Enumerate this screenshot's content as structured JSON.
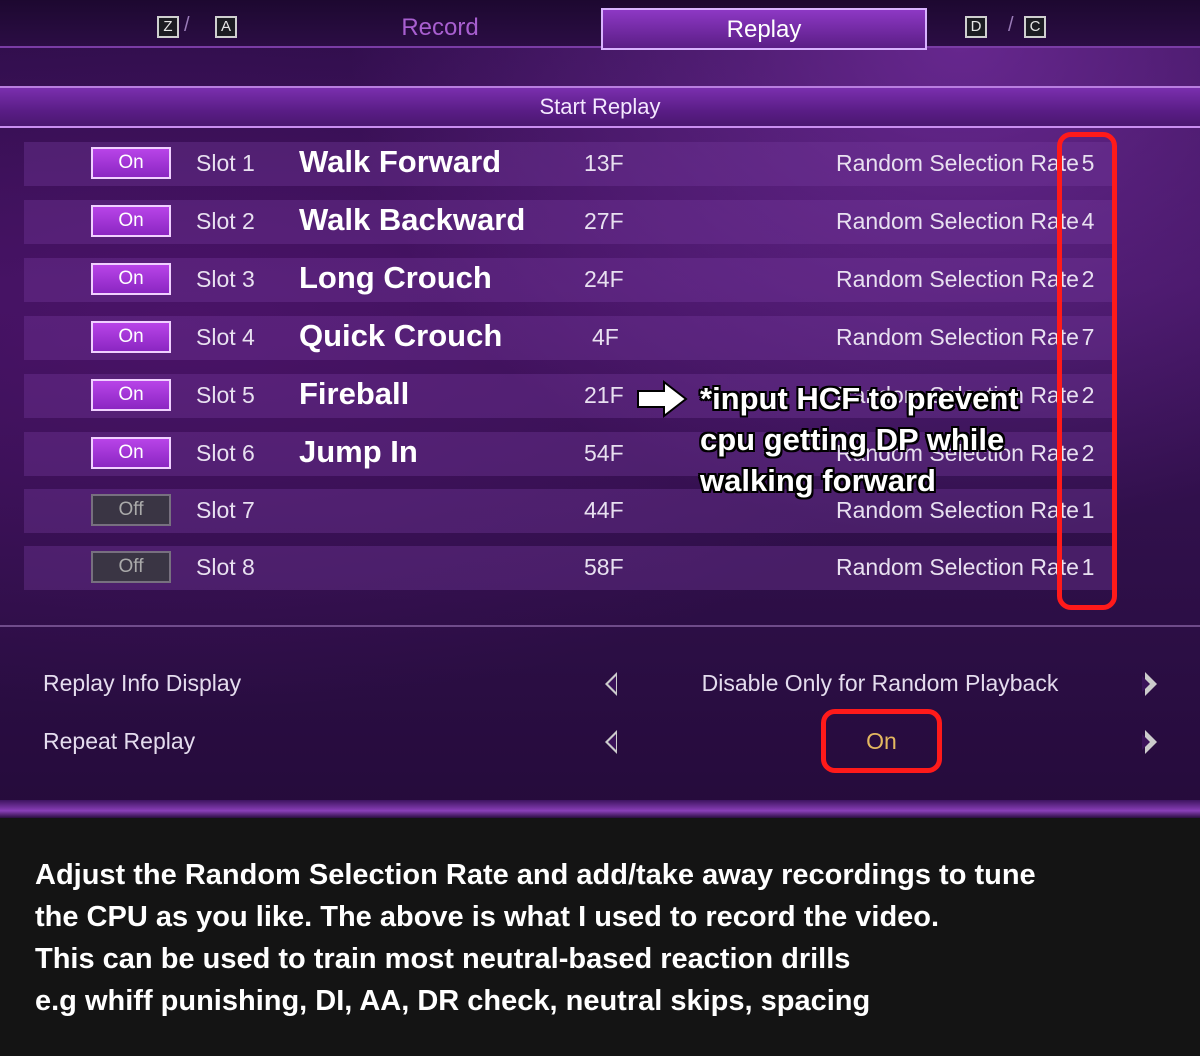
{
  "tabbar": {
    "left_keys": [
      "Z",
      "A"
    ],
    "right_keys": [
      "D",
      "C"
    ],
    "tabs": [
      {
        "label": "Record",
        "active": false
      },
      {
        "label": "Replay",
        "active": true
      }
    ]
  },
  "start_replay": {
    "label": "Start Replay"
  },
  "slots": [
    {
      "toggle": "On",
      "slot": "Slot 1",
      "move": "Walk Forward",
      "frames": "13F",
      "rate_label": "Random Selection Rate",
      "rate": "5"
    },
    {
      "toggle": "On",
      "slot": "Slot 2",
      "move": "Walk Backward",
      "frames": "27F",
      "rate_label": "Random Selection Rate",
      "rate": "4"
    },
    {
      "toggle": "On",
      "slot": "Slot 3",
      "move": "Long Crouch",
      "frames": "24F",
      "rate_label": "Random Selection Rate",
      "rate": "2"
    },
    {
      "toggle": "On",
      "slot": "Slot 4",
      "move": "Quick Crouch",
      "frames": "4F",
      "rate_label": "Random Selection Rate",
      "rate": "7"
    },
    {
      "toggle": "On",
      "slot": "Slot 5",
      "move": "Fireball",
      "frames": "21F",
      "rate_label": "Random Selection Rate",
      "rate": "2"
    },
    {
      "toggle": "On",
      "slot": "Slot 6",
      "move": "Jump In",
      "frames": "54F",
      "rate_label": "Random Selection Rate",
      "rate": "2"
    },
    {
      "toggle": "Off",
      "slot": "Slot 7",
      "move": "",
      "frames": "44F",
      "rate_label": "Random Selection Rate",
      "rate": "1"
    },
    {
      "toggle": "Off",
      "slot": "Slot 8",
      "move": "",
      "frames": "58F",
      "rate_label": "Random Selection Rate",
      "rate": "1"
    }
  ],
  "options": {
    "replay_info": {
      "label": "Replay Info Display",
      "value": "Disable Only for Random Playback"
    },
    "repeat_replay": {
      "label": "Repeat Replay",
      "value": "On"
    }
  },
  "annotation": {
    "lines": [
      "*input HCF to prevent",
      "cpu getting DP while",
      "walking forward"
    ]
  },
  "caption": {
    "lines": [
      "Adjust the Random Selection Rate and add/take away recordings to tune",
      "the CPU as you like. The above is what I used to record the video.",
      "This can be used to train most neutral-based reaction drills",
      "e.g whiff punishing, DI, AA, DR check, neutral skips, spacing"
    ]
  },
  "colors": {
    "accent": "#8d38c4",
    "highlight": "#ff1a1a",
    "toggle_on": "#b844e8"
  }
}
